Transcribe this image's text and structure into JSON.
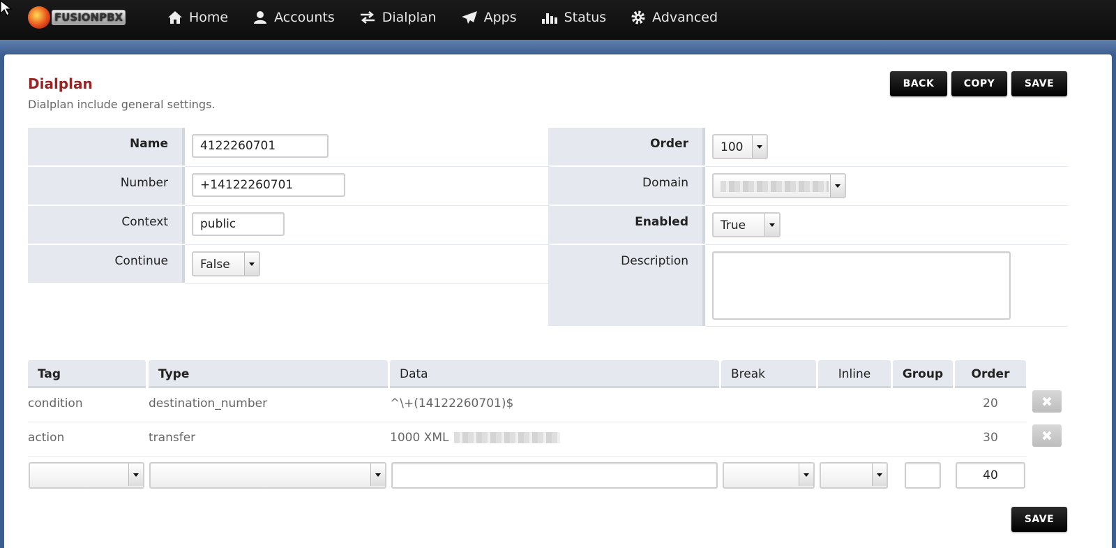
{
  "nav": {
    "logo_text": "FUSIONPBX",
    "items": [
      {
        "label": "Home",
        "icon": "home-icon"
      },
      {
        "label": "Accounts",
        "icon": "user-icon"
      },
      {
        "label": "Dialplan",
        "icon": "exchange-icon"
      },
      {
        "label": "Apps",
        "icon": "paper-plane-icon"
      },
      {
        "label": "Status",
        "icon": "bar-chart-icon"
      },
      {
        "label": "Advanced",
        "icon": "gear-icon"
      }
    ]
  },
  "page": {
    "title": "Dialplan",
    "subtitle": "Dialplan include general settings.",
    "back_label": "BACK",
    "copy_label": "COPY",
    "save_label": "SAVE",
    "save_bottom_label": "SAVE"
  },
  "form": {
    "name_label": "Name",
    "name_value": "4122260701",
    "number_label": "Number",
    "number_value": "+14122260701",
    "context_label": "Context",
    "context_value": "public",
    "continue_label": "Continue",
    "continue_value": "False",
    "order_label": "Order",
    "order_value": "100",
    "domain_label": "Domain",
    "enabled_label": "Enabled",
    "enabled_value": "True",
    "description_label": "Description",
    "description_value": ""
  },
  "details": {
    "headers": {
      "tag": "Tag",
      "type": "Type",
      "data": "Data",
      "break": "Break",
      "inline": "Inline",
      "group": "Group",
      "order": "Order"
    },
    "rows": [
      {
        "tag": "condition",
        "type": "destination_number",
        "data": "^\\+(14122260701)$",
        "order": "20"
      },
      {
        "tag": "action",
        "type": "transfer",
        "data": "1000 XML",
        "order": "30"
      }
    ],
    "new_row": {
      "order": "40"
    }
  },
  "colors": {
    "title": "#952424",
    "nav_bg": "#111111",
    "label_bg": "#e5e9ef",
    "button_bg": "#000000"
  }
}
